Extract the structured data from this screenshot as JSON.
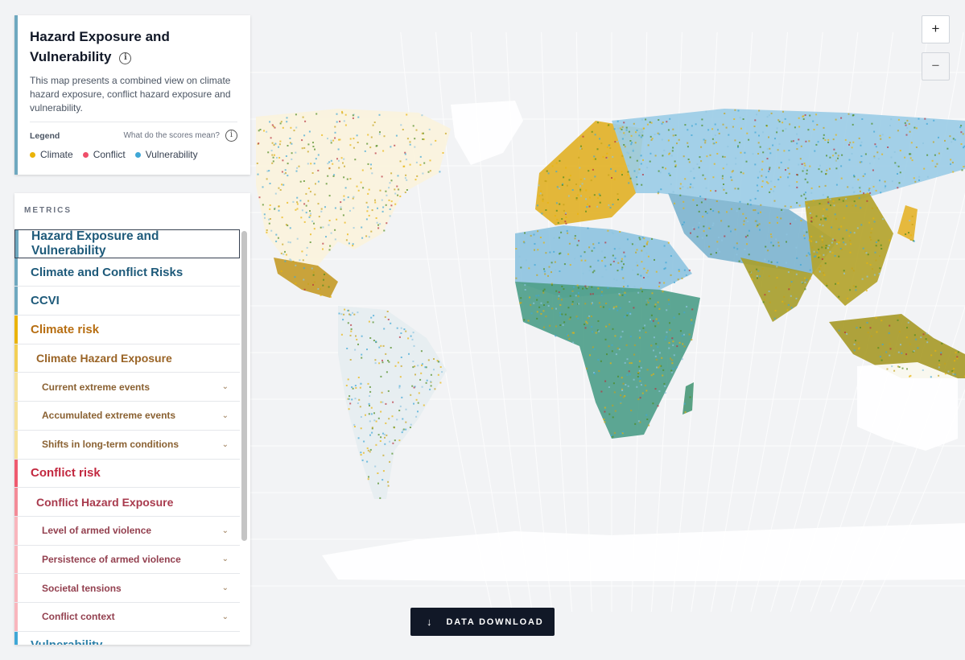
{
  "info": {
    "title": "Hazard Exposure and Vulnerability",
    "description": "This map presents a combined view on climate hazard exposure, conflict hazard exposure and vulnerability.",
    "legend_label": "Legend",
    "scores_question": "What do the scores mean?",
    "info_icon": "info-icon",
    "legend_items": [
      {
        "label": "Climate",
        "color": "#eab308"
      },
      {
        "label": "Conflict",
        "color": "#ef4f6a"
      },
      {
        "label": "Vulnerability",
        "color": "#3fa7d6"
      }
    ]
  },
  "metrics": {
    "title": "METRICS",
    "items": [
      {
        "label": "Hazard Exposure and Vulnerability",
        "level": 0,
        "active": true,
        "bar": "#6fa8bf",
        "color": "#1e5a7a",
        "expandable": false
      },
      {
        "label": "Climate and Conflict Risks",
        "level": 0,
        "active": false,
        "bar": "#6fa8bf",
        "color": "#1e5a7a",
        "expandable": false
      },
      {
        "label": "CCVI",
        "level": 0,
        "active": false,
        "bar": "#6fa8bf",
        "color": "#1e5a7a",
        "expandable": false
      },
      {
        "label": "Climate risk",
        "level": 0,
        "active": false,
        "bar": "#eab308",
        "color": "#b76e12",
        "expandable": false
      },
      {
        "label": "Climate Hazard Exposure",
        "level": 1,
        "active": false,
        "bar": "#f2cf55",
        "color": "#9a6426",
        "expandable": false
      },
      {
        "label": "Current extreme events",
        "level": 2,
        "active": false,
        "bar": "#f6e29a",
        "color": "#8a6132",
        "expandable": true
      },
      {
        "label": "Accumulated extreme events",
        "level": 2,
        "active": false,
        "bar": "#f6e29a",
        "color": "#8a6132",
        "expandable": true
      },
      {
        "label": "Shifts in long-term conditions",
        "level": 2,
        "active": false,
        "bar": "#f6e29a",
        "color": "#8a6132",
        "expandable": true
      },
      {
        "label": "Conflict risk",
        "level": 0,
        "active": false,
        "bar": "#ef5a6f",
        "color": "#c2283f",
        "expandable": false
      },
      {
        "label": "Conflict Hazard Exposure",
        "level": 1,
        "active": false,
        "bar": "#f38b98",
        "color": "#a83a4d",
        "expandable": false
      },
      {
        "label": "Level of armed violence",
        "level": 2,
        "active": false,
        "bar": "#f9b6bd",
        "color": "#93404f",
        "expandable": true
      },
      {
        "label": "Persistence of armed violence",
        "level": 2,
        "active": false,
        "bar": "#f9b6bd",
        "color": "#93404f",
        "expandable": true
      },
      {
        "label": "Societal tensions",
        "level": 2,
        "active": false,
        "bar": "#f9b6bd",
        "color": "#93404f",
        "expandable": true
      },
      {
        "label": "Conflict context",
        "level": 2,
        "active": false,
        "bar": "#f9b6bd",
        "color": "#93404f",
        "expandable": true
      },
      {
        "label": "Vulnerability",
        "level": 0,
        "active": false,
        "bar": "#3fa7d6",
        "color": "#2a7fa8",
        "expandable": false
      }
    ],
    "chevron_icon": "chevron-down-icon"
  },
  "zoom": {
    "in_label": "+",
    "out_label": "−"
  },
  "download": {
    "label": "DATA DOWNLOAD",
    "icon": "arrow-down-icon",
    "arrow": "↓"
  }
}
